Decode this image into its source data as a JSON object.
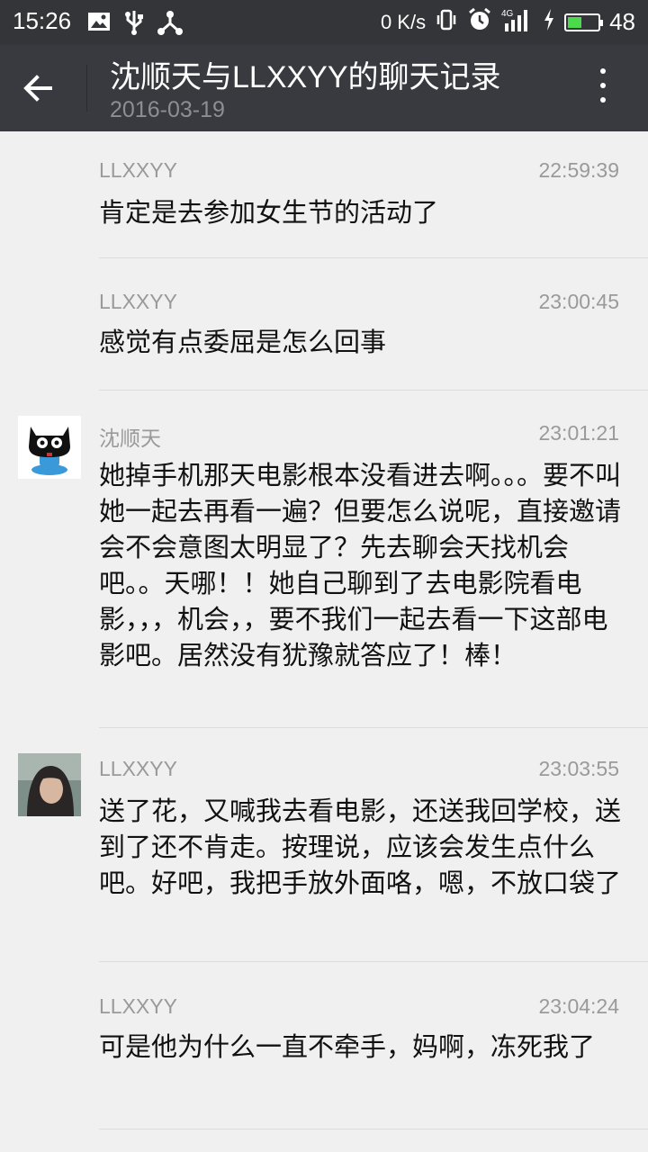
{
  "status_bar": {
    "time": "15:26",
    "network_speed": "0 K/s",
    "signal": "4G",
    "battery": "48",
    "battery_level": 0.48,
    "battery_color": "#4cd94c"
  },
  "header": {
    "title": "沈顺天与LLXXYY的聊天记录",
    "date": "2016-03-19"
  },
  "messages": [
    {
      "sender": "LLXXYY",
      "time": "22:59:39",
      "text": "肯定是去参加女生节的活动了",
      "avatar": null
    },
    {
      "sender": "LLXXYY",
      "time": "23:00:45",
      "text": "感觉有点委屈是怎么回事",
      "avatar": null
    },
    {
      "sender": "沈顺天",
      "time": "23:01:21",
      "text": "她掉手机那天电影根本没看进去啊。。。要不叫她一起去再看一遍？但要怎么说呢，直接邀请会不会意图太明显了？先去聊会天找机会吧。。天哪！！她自己聊到了去电影院看电影，，，机会，，要不我们一起去看一下这部电影吧。居然没有犹豫就答应了！棒！",
      "avatar": "octocat-avatar"
    },
    {
      "sender": "LLXXYY",
      "time": "23:03:55",
      "text": "送了花，又喊我去看电影，还送我回学校，送到了还不肯走。按理说，应该会发生点什么吧。好吧，我把手放外面咯，嗯，不放口袋了",
      "avatar": "photo-avatar"
    },
    {
      "sender": "LLXXYY",
      "time": "23:04:24",
      "text": "可是他为什么一直不牵手，妈啊，冻死我了",
      "avatar": null
    }
  ]
}
